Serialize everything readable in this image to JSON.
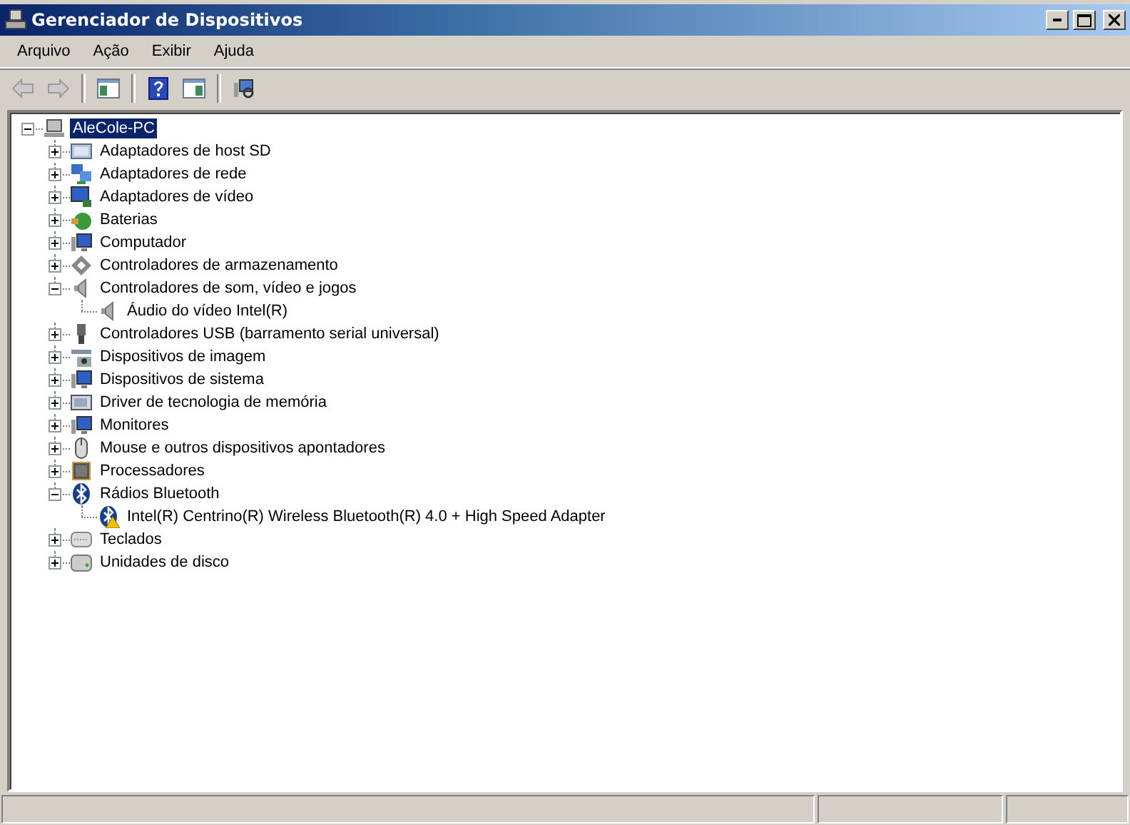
{
  "window": {
    "title": "Gerenciador de Dispositivos"
  },
  "menu": [
    {
      "label": "Arquivo"
    },
    {
      "label": "Ação"
    },
    {
      "label": "Exibir"
    },
    {
      "label": "Ajuda"
    }
  ],
  "toolbar": [
    {
      "kind": "back",
      "disabled": true
    },
    {
      "kind": "forward",
      "disabled": true
    },
    {
      "kind": "separator"
    },
    {
      "kind": "tree",
      "disabled": false
    },
    {
      "kind": "separator"
    },
    {
      "kind": "help",
      "disabled": false
    },
    {
      "kind": "panel",
      "disabled": false
    },
    {
      "kind": "separator"
    },
    {
      "kind": "scan",
      "disabled": false
    }
  ],
  "tree": {
    "label": "AleCole-PC",
    "kind": "computer",
    "selected": true,
    "expanded": true,
    "children": [
      {
        "label": "Adaptadores de host SD",
        "kind": "card",
        "expanded": false
      },
      {
        "label": "Adaptadores de rede",
        "kind": "network",
        "expanded": false
      },
      {
        "label": "Adaptadores de vídeo",
        "kind": "display",
        "expanded": false
      },
      {
        "label": "Baterias",
        "kind": "battery",
        "expanded": false
      },
      {
        "label": "Computador",
        "kind": "monitor",
        "expanded": false
      },
      {
        "label": "Controladores de armazenamento",
        "kind": "storage",
        "expanded": false
      },
      {
        "label": "Controladores de som, vídeo e jogos",
        "kind": "speaker",
        "expanded": true,
        "children": [
          {
            "label": "Áudio do vídeo Intel(R)",
            "kind": "speaker",
            "warning": false
          }
        ]
      },
      {
        "label": "Controladores USB (barramento serial universal)",
        "kind": "usb",
        "expanded": false
      },
      {
        "label": "Dispositivos de imagem",
        "kind": "camera",
        "expanded": false
      },
      {
        "label": "Dispositivos de sistema",
        "kind": "monitor",
        "expanded": false
      },
      {
        "label": "Driver de tecnologia de memória",
        "kind": "memory",
        "expanded": false
      },
      {
        "label": "Monitores",
        "kind": "monitor",
        "expanded": false
      },
      {
        "label": "Mouse e outros dispositivos apontadores",
        "kind": "mouse",
        "expanded": false
      },
      {
        "label": "Processadores",
        "kind": "chip",
        "expanded": false
      },
      {
        "label": "Rádios Bluetooth",
        "kind": "bluetooth",
        "expanded": true,
        "children": [
          {
            "label": "Intel(R) Centrino(R) Wireless Bluetooth(R) 4.0 + High Speed Adapter",
            "kind": "bluetooth",
            "warning": true
          }
        ]
      },
      {
        "label": "Teclados",
        "kind": "keyboard",
        "expanded": false
      },
      {
        "label": "Unidades de disco",
        "kind": "disk",
        "expanded": false
      }
    ]
  }
}
